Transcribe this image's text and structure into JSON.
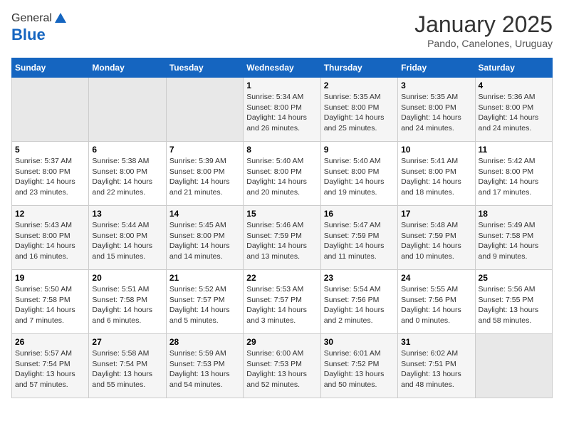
{
  "header": {
    "logo_general": "General",
    "logo_blue": "Blue",
    "title": "January 2025",
    "subtitle": "Pando, Canelones, Uruguay"
  },
  "days_of_week": [
    "Sunday",
    "Monday",
    "Tuesday",
    "Wednesday",
    "Thursday",
    "Friday",
    "Saturday"
  ],
  "weeks": [
    [
      {
        "day": "",
        "detail": ""
      },
      {
        "day": "",
        "detail": ""
      },
      {
        "day": "",
        "detail": ""
      },
      {
        "day": "1",
        "detail": "Sunrise: 5:34 AM\nSunset: 8:00 PM\nDaylight: 14 hours\nand 26 minutes."
      },
      {
        "day": "2",
        "detail": "Sunrise: 5:35 AM\nSunset: 8:00 PM\nDaylight: 14 hours\nand 25 minutes."
      },
      {
        "day": "3",
        "detail": "Sunrise: 5:35 AM\nSunset: 8:00 PM\nDaylight: 14 hours\nand 24 minutes."
      },
      {
        "day": "4",
        "detail": "Sunrise: 5:36 AM\nSunset: 8:00 PM\nDaylight: 14 hours\nand 24 minutes."
      }
    ],
    [
      {
        "day": "5",
        "detail": "Sunrise: 5:37 AM\nSunset: 8:00 PM\nDaylight: 14 hours\nand 23 minutes."
      },
      {
        "day": "6",
        "detail": "Sunrise: 5:38 AM\nSunset: 8:00 PM\nDaylight: 14 hours\nand 22 minutes."
      },
      {
        "day": "7",
        "detail": "Sunrise: 5:39 AM\nSunset: 8:00 PM\nDaylight: 14 hours\nand 21 minutes."
      },
      {
        "day": "8",
        "detail": "Sunrise: 5:40 AM\nSunset: 8:00 PM\nDaylight: 14 hours\nand 20 minutes."
      },
      {
        "day": "9",
        "detail": "Sunrise: 5:40 AM\nSunset: 8:00 PM\nDaylight: 14 hours\nand 19 minutes."
      },
      {
        "day": "10",
        "detail": "Sunrise: 5:41 AM\nSunset: 8:00 PM\nDaylight: 14 hours\nand 18 minutes."
      },
      {
        "day": "11",
        "detail": "Sunrise: 5:42 AM\nSunset: 8:00 PM\nDaylight: 14 hours\nand 17 minutes."
      }
    ],
    [
      {
        "day": "12",
        "detail": "Sunrise: 5:43 AM\nSunset: 8:00 PM\nDaylight: 14 hours\nand 16 minutes."
      },
      {
        "day": "13",
        "detail": "Sunrise: 5:44 AM\nSunset: 8:00 PM\nDaylight: 14 hours\nand 15 minutes."
      },
      {
        "day": "14",
        "detail": "Sunrise: 5:45 AM\nSunset: 8:00 PM\nDaylight: 14 hours\nand 14 minutes."
      },
      {
        "day": "15",
        "detail": "Sunrise: 5:46 AM\nSunset: 7:59 PM\nDaylight: 14 hours\nand 13 minutes."
      },
      {
        "day": "16",
        "detail": "Sunrise: 5:47 AM\nSunset: 7:59 PM\nDaylight: 14 hours\nand 11 minutes."
      },
      {
        "day": "17",
        "detail": "Sunrise: 5:48 AM\nSunset: 7:59 PM\nDaylight: 14 hours\nand 10 minutes."
      },
      {
        "day": "18",
        "detail": "Sunrise: 5:49 AM\nSunset: 7:58 PM\nDaylight: 14 hours\nand 9 minutes."
      }
    ],
    [
      {
        "day": "19",
        "detail": "Sunrise: 5:50 AM\nSunset: 7:58 PM\nDaylight: 14 hours\nand 7 minutes."
      },
      {
        "day": "20",
        "detail": "Sunrise: 5:51 AM\nSunset: 7:58 PM\nDaylight: 14 hours\nand 6 minutes."
      },
      {
        "day": "21",
        "detail": "Sunrise: 5:52 AM\nSunset: 7:57 PM\nDaylight: 14 hours\nand 5 minutes."
      },
      {
        "day": "22",
        "detail": "Sunrise: 5:53 AM\nSunset: 7:57 PM\nDaylight: 14 hours\nand 3 minutes."
      },
      {
        "day": "23",
        "detail": "Sunrise: 5:54 AM\nSunset: 7:56 PM\nDaylight: 14 hours\nand 2 minutes."
      },
      {
        "day": "24",
        "detail": "Sunrise: 5:55 AM\nSunset: 7:56 PM\nDaylight: 14 hours\nand 0 minutes."
      },
      {
        "day": "25",
        "detail": "Sunrise: 5:56 AM\nSunset: 7:55 PM\nDaylight: 13 hours\nand 58 minutes."
      }
    ],
    [
      {
        "day": "26",
        "detail": "Sunrise: 5:57 AM\nSunset: 7:54 PM\nDaylight: 13 hours\nand 57 minutes."
      },
      {
        "day": "27",
        "detail": "Sunrise: 5:58 AM\nSunset: 7:54 PM\nDaylight: 13 hours\nand 55 minutes."
      },
      {
        "day": "28",
        "detail": "Sunrise: 5:59 AM\nSunset: 7:53 PM\nDaylight: 13 hours\nand 54 minutes."
      },
      {
        "day": "29",
        "detail": "Sunrise: 6:00 AM\nSunset: 7:53 PM\nDaylight: 13 hours\nand 52 minutes."
      },
      {
        "day": "30",
        "detail": "Sunrise: 6:01 AM\nSunset: 7:52 PM\nDaylight: 13 hours\nand 50 minutes."
      },
      {
        "day": "31",
        "detail": "Sunrise: 6:02 AM\nSunset: 7:51 PM\nDaylight: 13 hours\nand 48 minutes."
      },
      {
        "day": "",
        "detail": ""
      }
    ]
  ]
}
